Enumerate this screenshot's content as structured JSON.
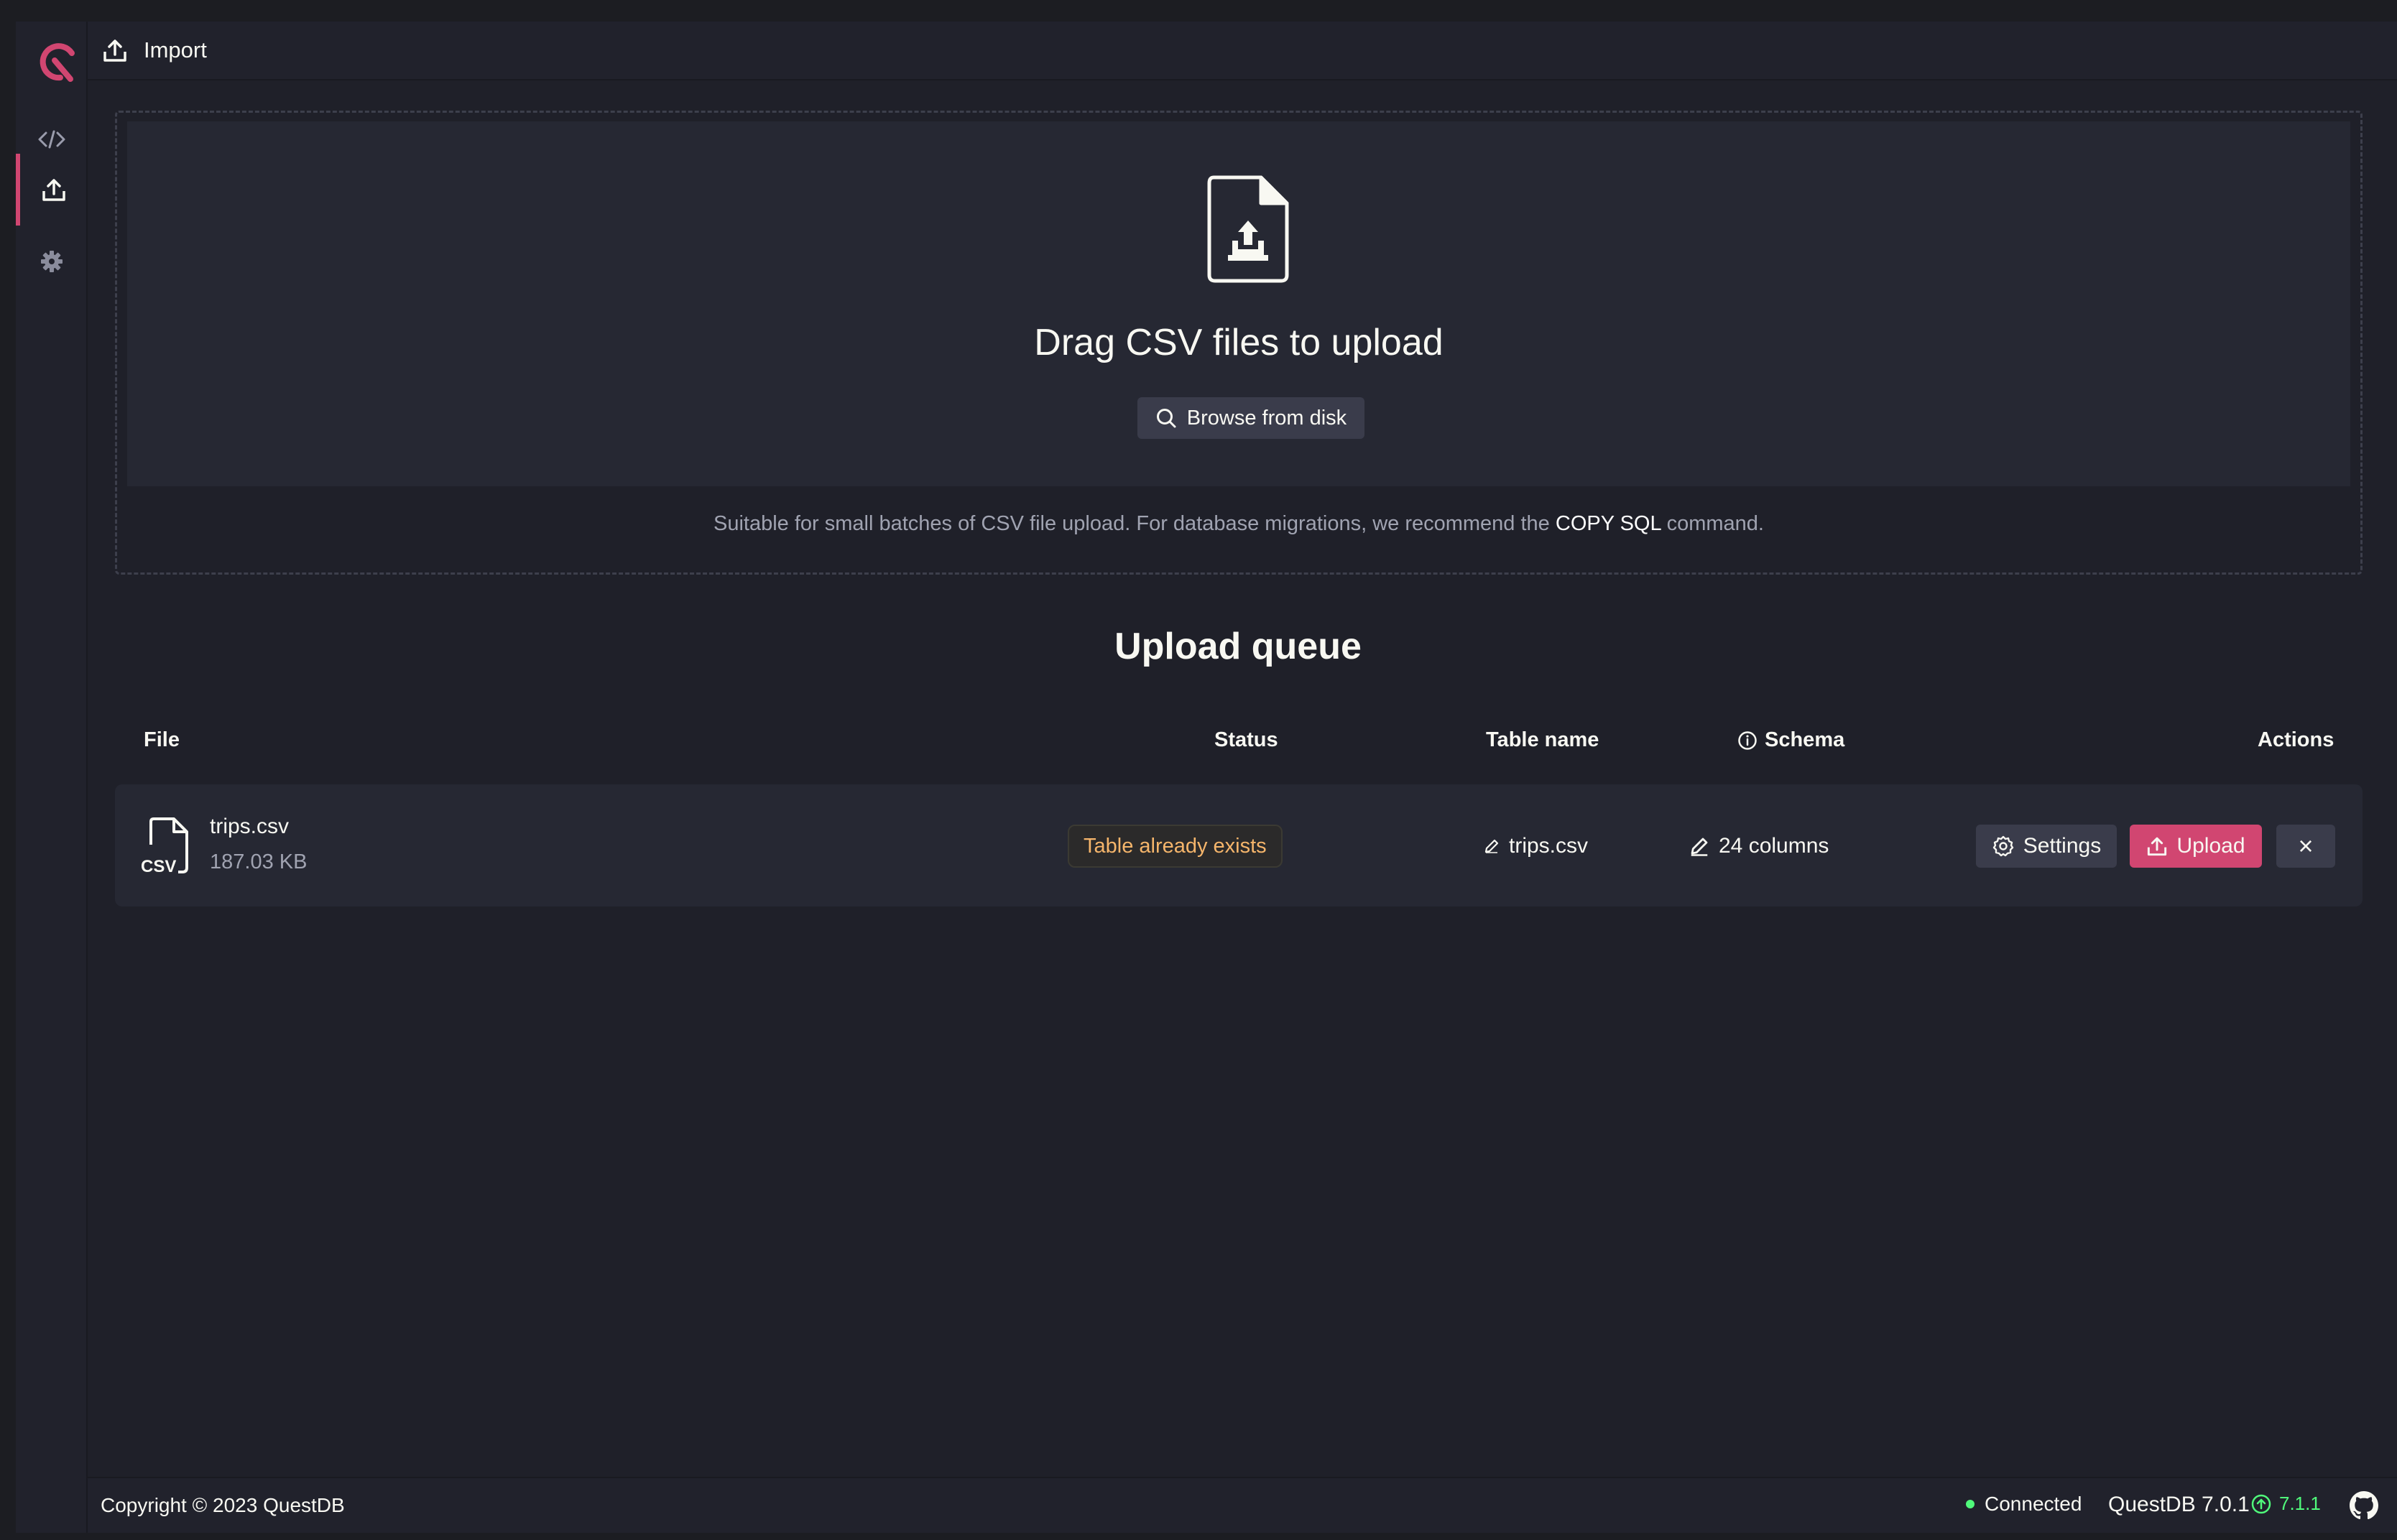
{
  "app": {
    "title": "Import",
    "brand_color": "#d14671"
  },
  "sidebar": {
    "items": [
      {
        "icon": "code-icon",
        "active": false
      },
      {
        "icon": "upload-icon",
        "active": true
      },
      {
        "icon": "gear-icon",
        "active": false
      }
    ]
  },
  "dropzone": {
    "title": "Drag CSV files to upload",
    "browse_label": "Browse from disk",
    "note_prefix": "Suitable for small batches of CSV file upload. For database migrations, we recommend the ",
    "note_highlight": "COPY SQL",
    "note_suffix": " command."
  },
  "queue": {
    "title": "Upload queue",
    "columns": {
      "file": "File",
      "status": "Status",
      "table_name": "Table name",
      "schema": "Schema",
      "actions": "Actions"
    },
    "rows": [
      {
        "file_icon_label": "CSV",
        "file_name": "trips.csv",
        "file_size": "187.03 KB",
        "status": "Table already exists",
        "status_color": "#f5b56b",
        "table_name": "trips.csv",
        "schema": "24 columns",
        "settings_label": "Settings",
        "upload_label": "Upload",
        "remove_label": "×"
      }
    ]
  },
  "footer": {
    "copyright": "Copyright © 2023 QuestDB",
    "connection": "Connected",
    "version": "QuestDB 7.0.1",
    "update_version": "7.1.1"
  }
}
